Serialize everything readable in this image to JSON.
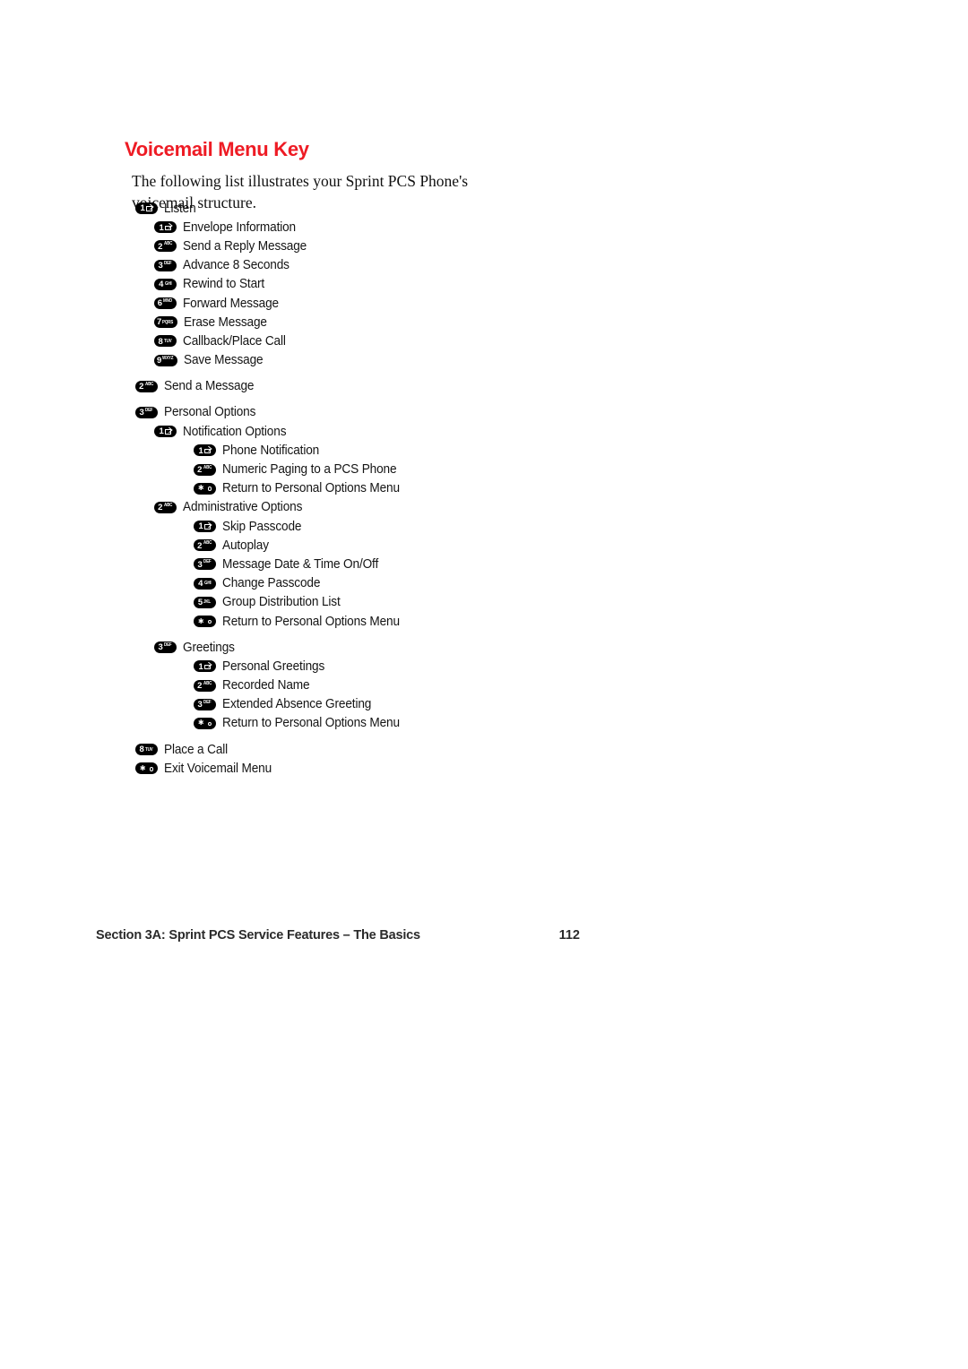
{
  "heading": "Voicemail Menu Key",
  "intro": "The following list illustrates your Sprint PCS Phone's voicemail structure.",
  "colors": {
    "heading_red": "#ee1b24",
    "key_background": "#000000",
    "key_foreground": "#ffffff",
    "body_text": "#141414",
    "footer_text": "#2b2b2b"
  },
  "menu": [
    {
      "level": 1,
      "key_num": "1",
      "key_sub": "envelope",
      "label": "Listen",
      "gap_before": false
    },
    {
      "level": 2,
      "key_num": "1",
      "key_sub": "envelope",
      "label": "Envelope Information",
      "gap_before": false
    },
    {
      "level": 2,
      "key_num": "2",
      "key_sub": "ABC",
      "label": "Send a Reply Message",
      "gap_before": false
    },
    {
      "level": 2,
      "key_num": "3",
      "key_sub": "DEF",
      "label": "Advance 8 Seconds",
      "gap_before": false
    },
    {
      "level": 2,
      "key_num": "4",
      "key_sub": "GHI",
      "label": "Rewind to Start",
      "gap_before": false
    },
    {
      "level": 2,
      "key_num": "6",
      "key_sub": "MNO",
      "label": "Forward Message",
      "gap_before": false
    },
    {
      "level": 2,
      "key_num": "7",
      "key_sub": "PQRS",
      "label": "Erase Message",
      "gap_before": false
    },
    {
      "level": 2,
      "key_num": "8",
      "key_sub": "TUV",
      "label": "Callback/Place Call",
      "gap_before": false
    },
    {
      "level": 2,
      "key_num": "9",
      "key_sub": "WXYZ",
      "label": "Save Message",
      "gap_before": false
    },
    {
      "level": 1,
      "key_num": "2",
      "key_sub": "ABC",
      "label": "Send a Message",
      "gap_before": true
    },
    {
      "level": 1,
      "key_num": "3",
      "key_sub": "DEF",
      "label": "Personal Options",
      "gap_before": true
    },
    {
      "level": 2,
      "key_num": "1",
      "key_sub": "envelope",
      "label": "Notification Options",
      "gap_before": false
    },
    {
      "level": 3,
      "key_num": "1",
      "key_sub": "envelope",
      "label": "Phone Notification",
      "gap_before": false
    },
    {
      "level": 3,
      "key_num": "2",
      "key_sub": "ABC",
      "label": "Numeric Paging to a PCS Phone",
      "gap_before": false
    },
    {
      "level": 3,
      "key_num": "*",
      "key_sub": "dot",
      "label": "Return to Personal Options Menu",
      "gap_before": false
    },
    {
      "level": 2,
      "key_num": "2",
      "key_sub": "ABC",
      "label": "Administrative Options",
      "gap_before": false
    },
    {
      "level": 3,
      "key_num": "1",
      "key_sub": "envelope",
      "label": "Skip Passcode",
      "gap_before": false
    },
    {
      "level": 3,
      "key_num": "2",
      "key_sub": "ABC",
      "label": "Autoplay",
      "gap_before": false
    },
    {
      "level": 3,
      "key_num": "3",
      "key_sub": "DEF",
      "label": "Message Date & Time On/Off",
      "gap_before": false
    },
    {
      "level": 3,
      "key_num": "4",
      "key_sub": "GHI",
      "label": "Change Passcode",
      "gap_before": false
    },
    {
      "level": 3,
      "key_num": "5",
      "key_sub": "JKL",
      "label": "Group Distribution List",
      "gap_before": false
    },
    {
      "level": 3,
      "key_num": "*",
      "key_sub": "dot",
      "label": "Return to Personal Options Menu",
      "gap_before": false
    },
    {
      "level": 2,
      "key_num": "3",
      "key_sub": "DEF",
      "label": "Greetings",
      "gap_before": true
    },
    {
      "level": 3,
      "key_num": "1",
      "key_sub": "envelope",
      "label": "Personal Greetings",
      "gap_before": false
    },
    {
      "level": 3,
      "key_num": "2",
      "key_sub": "ABC",
      "label": "Recorded Name",
      "gap_before": false
    },
    {
      "level": 3,
      "key_num": "3",
      "key_sub": "DEF",
      "label": "Extended Absence Greeting",
      "gap_before": false
    },
    {
      "level": 3,
      "key_num": "*",
      "key_sub": "dot",
      "label": "Return to Personal Options Menu",
      "gap_before": false
    },
    {
      "level": 1,
      "key_num": "8",
      "key_sub": "TUV",
      "label": "Place a Call",
      "gap_before": true
    },
    {
      "level": 1,
      "key_num": "*",
      "key_sub": "dot",
      "label": "Exit Voicemail Menu",
      "gap_before": false
    }
  ],
  "footer": {
    "title": "Section 3A: Sprint PCS Service Features – The Basics",
    "page_number": "112"
  }
}
